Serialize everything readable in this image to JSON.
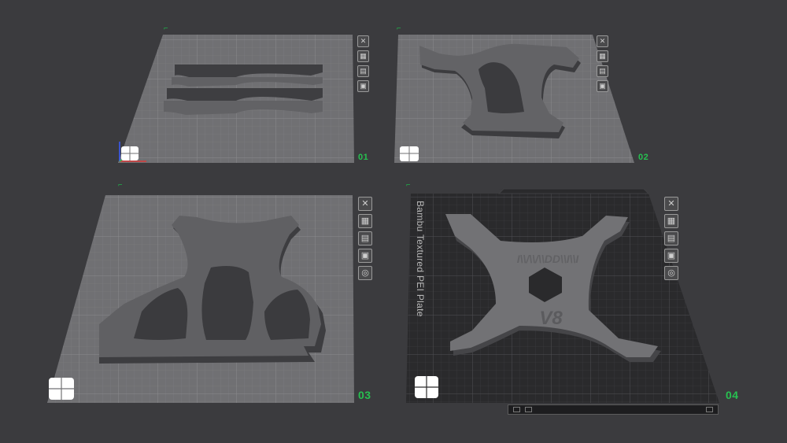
{
  "plates": [
    {
      "number": "01",
      "icons": [
        "close-icon",
        "arrange-icon",
        "auto-orient-icon",
        "lock-icon"
      ]
    },
    {
      "number": "02",
      "icons": [
        "close-icon",
        "arrange-icon",
        "auto-orient-icon",
        "lock-icon"
      ]
    },
    {
      "number": "03",
      "icons": [
        "close-icon",
        "arrange-icon",
        "auto-orient-icon",
        "lock-icon",
        "settings-icon"
      ]
    },
    {
      "number": "04",
      "icons": [
        "close-icon",
        "arrange-icon",
        "auto-orient-icon",
        "lock-icon",
        "settings-icon"
      ]
    }
  ],
  "plate_4_bed_label": "Bambu Textured PEI Plate",
  "plate_4_model_text": "V8",
  "colors": {
    "background": "#3b3b3e",
    "plate": "#6f6f71",
    "grid": "#7d7d80",
    "model": "#5f5f62",
    "model_side": "#3e3e41",
    "pei": "#2a2a2c",
    "accent": "#27c050"
  }
}
